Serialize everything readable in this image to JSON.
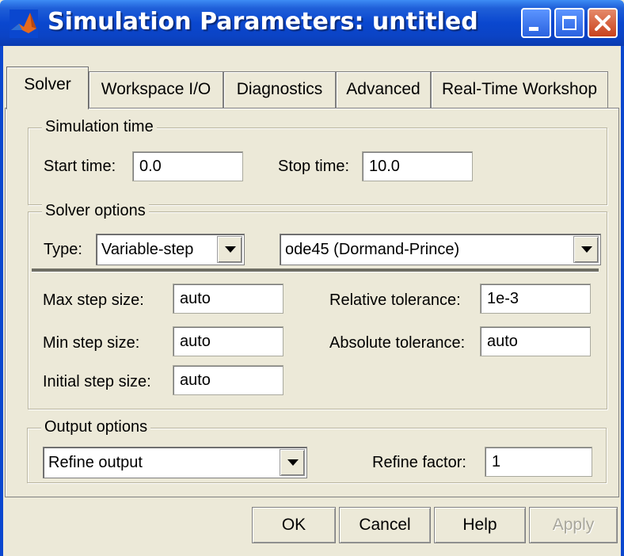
{
  "window": {
    "title": "Simulation Parameters: untitled",
    "controls": [
      "minimize-icon",
      "maximize-icon",
      "close-icon"
    ]
  },
  "tabs": [
    {
      "label": "Solver",
      "active": true
    },
    {
      "label": "Workspace I/O",
      "active": false
    },
    {
      "label": "Diagnostics",
      "active": false
    },
    {
      "label": "Advanced",
      "active": false
    },
    {
      "label": "Real-Time Workshop",
      "active": false
    }
  ],
  "simulation_time": {
    "group_label": "Simulation time",
    "start_label": "Start time:",
    "start_value": "0.0",
    "stop_label": "Stop time:",
    "stop_value": "10.0"
  },
  "solver_options": {
    "group_label": "Solver options",
    "type_label": "Type:",
    "type_value": "Variable-step",
    "solver_value": "ode45 (Dormand-Prince)",
    "max_step_label": "Max step size:",
    "max_step_value": "auto",
    "min_step_label": "Min step size:",
    "min_step_value": "auto",
    "initial_step_label": "Initial step size:",
    "initial_step_value": "auto",
    "rel_tol_label": "Relative tolerance:",
    "rel_tol_value": "1e-3",
    "abs_tol_label": "Absolute tolerance:",
    "abs_tol_value": "auto"
  },
  "output_options": {
    "group_label": "Output options",
    "mode_value": "Refine output",
    "refine_label": "Refine factor:",
    "refine_value": "1"
  },
  "buttons": {
    "ok": "OK",
    "cancel": "Cancel",
    "help": "Help",
    "apply": "Apply"
  },
  "colors": {
    "titlebar": "#0a47cf",
    "dialog_bg": "#ece9d8",
    "close_button": "#c9411c"
  }
}
